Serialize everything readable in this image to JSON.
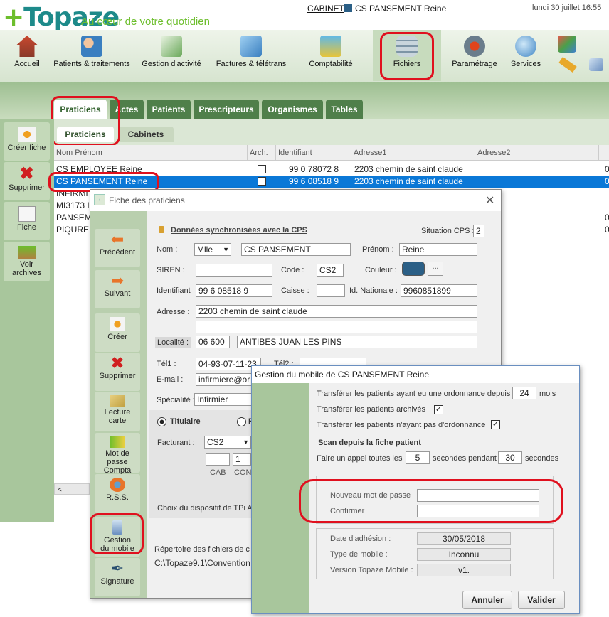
{
  "header": {
    "app_name": "Topaze",
    "tagline": "Au cœur de votre quotidien",
    "cabinet_label": "CABINET",
    "cabinet_name": "CS PANSEMENT Reine",
    "datetime": "lundi 30 juillet 16:55"
  },
  "toolbar": {
    "items": [
      {
        "label": "Accueil"
      },
      {
        "label": "Patients & traitements"
      },
      {
        "label": "Gestion d'activité"
      },
      {
        "label": "Factures & télétrans"
      },
      {
        "label": "Comptabilité"
      },
      {
        "label": "Fichiers"
      },
      {
        "label": "Paramétrage"
      },
      {
        "label": "Services"
      }
    ]
  },
  "left_panel": {
    "create": "Créer fiche",
    "delete": "Supprimer",
    "sheet": "Fiche",
    "archives_1": "Voir",
    "archives_2": "archives"
  },
  "tabs": [
    "Praticiens",
    "Actes",
    "Patients",
    "Prescripteurs",
    "Organismes",
    "Tables"
  ],
  "subtabs": [
    "Praticiens",
    "Cabinets"
  ],
  "list": {
    "columns": [
      "Nom Prénom",
      "Arch.",
      "Identifiant",
      "Adresse1",
      "Adresse2"
    ],
    "rows": [
      {
        "name": "CS EMPLOYEE Reine",
        "id": "99 0 78072 8",
        "addr": "2203 chemin de saint claude",
        "extra": "0"
      },
      {
        "name": "CS PANSEMENT Reine",
        "id": "99 6 08518 9",
        "addr": "2203 chemin de saint claude",
        "extra": "0"
      },
      {
        "name": "INFIRMI",
        "id": "",
        "addr": "",
        "extra": ""
      },
      {
        "name": "MI3173 I",
        "id": "",
        "addr": "",
        "extra": ""
      },
      {
        "name": "PANSEM",
        "id": "",
        "addr": "",
        "extra": "0"
      },
      {
        "name": "PIQURE",
        "id": "",
        "addr": "",
        "extra": "0"
      }
    ]
  },
  "fiche": {
    "title": "Fiche des praticiens",
    "side": {
      "prev": "Précédent",
      "next": "Suivant",
      "create": "Créer",
      "delete": "Supprimer",
      "card_1": "Lecture",
      "card_2": "carte",
      "pwd_1": "Mot de passe",
      "pwd_2": "Compta",
      "rss": "R.S.S.",
      "mobile_1": "Gestion",
      "mobile_2": "du mobile",
      "signature": "Signature"
    },
    "sync_label": "Données synchronisées avec la CPS",
    "situation_label": "Situation CPS :",
    "situation_value": "2",
    "nom_label": "Nom :",
    "civilite": "Mlle",
    "nom": "CS PANSEMENT",
    "prenom_label": "Prénom :",
    "prenom": "Reine",
    "siren_label": "SIREN :",
    "siren": "",
    "code_label": "Code :",
    "code": "CS2",
    "couleur_label": "Couleur :",
    "couleur_color": "#2b5f86",
    "ident_label": "Identifiant",
    "ident": "99 6 08518 9",
    "caisse_label": "Caisse :",
    "caisse": "",
    "idnat_label": "Id. Nationale :",
    "idnat": "9960851899",
    "adresse_label": "Adresse :",
    "adresse1": "2203 chemin de saint claude",
    "adresse2": "",
    "localite_label": "Localité :",
    "cp": "06 600",
    "ville": "ANTIBES JUAN LES PINS",
    "tel1_label": "Tél1 :",
    "tel1": "04-93-07-11-23",
    "tel2_label": "Tél2 :",
    "email_label": "E-mail :",
    "email": "infirmiere@or",
    "specialite_label": "Spécialité :",
    "specialite": "Infirmier",
    "titulaire": "Titulaire",
    "radio2": "R",
    "facturant_label": "Facturant :",
    "facturant": "CS2",
    "small_1": "",
    "small_2": "1",
    "cab_label": "CAB",
    "conv_label": "CONV",
    "tpi_label": "Choix du dispositif de TPi A",
    "rep_label": "Répertoire des fichiers de c",
    "rep_value": "C:\\Topaze9.1\\Convention"
  },
  "mobile": {
    "title": "Gestion du mobile de CS PANSEMENT Reine",
    "transfer_label": "Transférer les patients ayant eu une ordonnance depuis",
    "transfer_months": "24",
    "mois": "mois",
    "archived_label": "Transférer les patients archivés",
    "no_ordo_label": "Transférer les patients n'ayant pas d'ordonnance",
    "scan_title": "Scan depuis la fiche patient",
    "call_label": "Faire un appel toutes les",
    "call_every": "5",
    "seconds_during": "secondes pendant",
    "call_during": "30",
    "seconds": "secondes",
    "new_pwd_label": "Nouveau mot de passe",
    "confirm_label": "Confirmer",
    "adhesion_label": "Date d'adhésion :",
    "adhesion": "30/05/2018",
    "type_label": "Type de mobile :",
    "type": "Inconnu",
    "version_label": "Version Topaze Mobile :",
    "version": "v1.",
    "cancel": "Annuler",
    "ok": "Valider"
  }
}
